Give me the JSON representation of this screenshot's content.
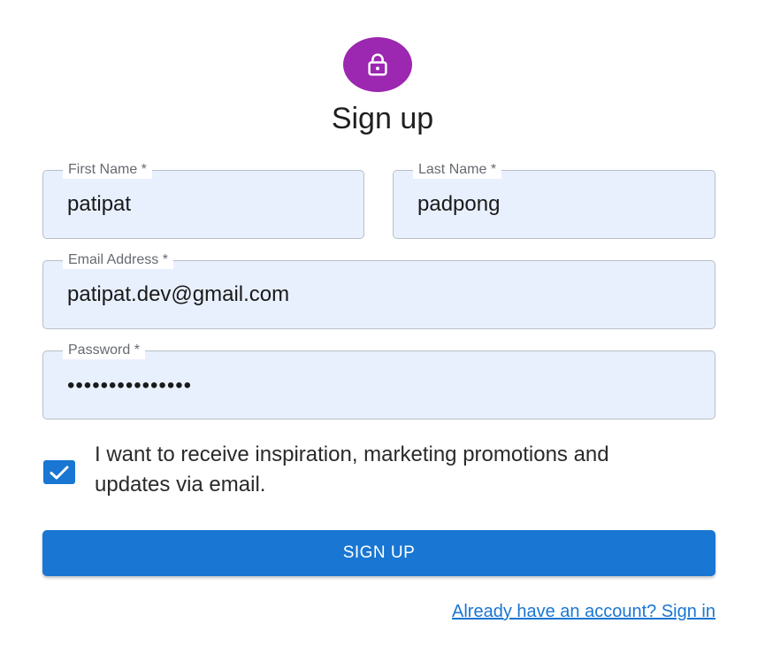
{
  "header": {
    "icon": "lock-icon",
    "title": "Sign up"
  },
  "form": {
    "first_name": {
      "label": "First Name *",
      "value": "patipat"
    },
    "last_name": {
      "label": "Last Name *",
      "value": "padpong"
    },
    "email": {
      "label": "Email Address *",
      "value": "patipat.dev@gmail.com"
    },
    "password": {
      "label": "Password *",
      "value": "•••••••••••••••"
    },
    "marketing_opt_in": {
      "checked": true,
      "label": "I want to receive inspiration, marketing promotions and updates via email."
    },
    "submit_label": "SIGN UP"
  },
  "footer": {
    "signin_link": "Already have an account? Sign in"
  },
  "colors": {
    "avatar": "#9c27b0",
    "primary": "#1976d2",
    "input_fill": "#e8f0fe"
  }
}
